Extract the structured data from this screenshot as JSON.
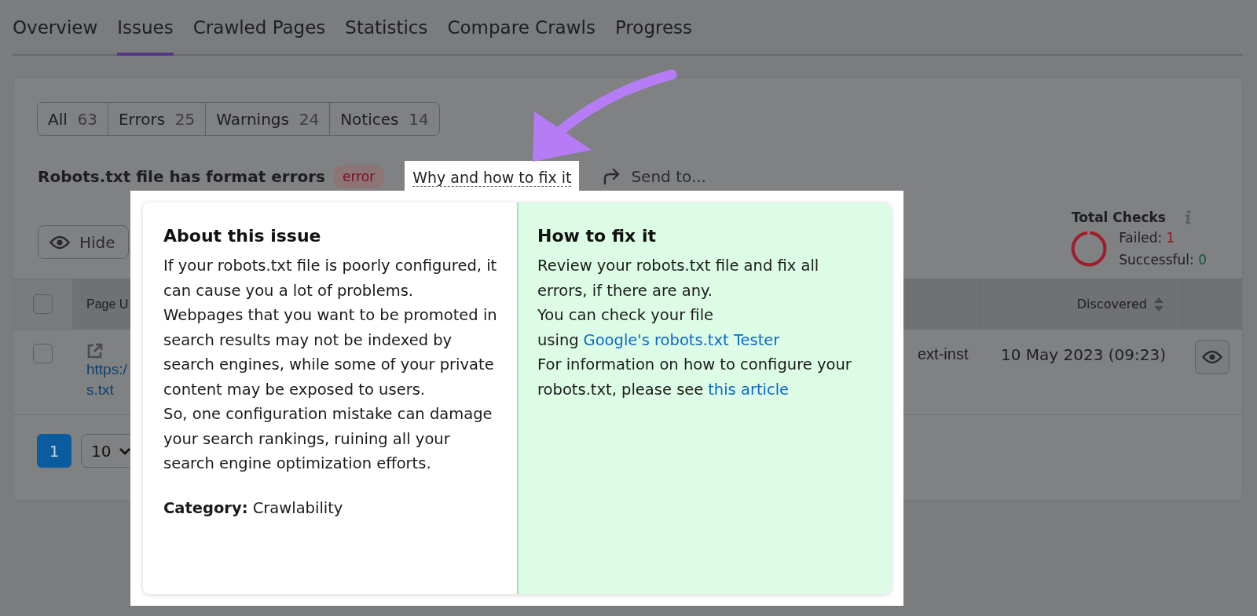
{
  "tabs": [
    {
      "label": "Overview",
      "selected": false
    },
    {
      "label": "Issues",
      "selected": true
    },
    {
      "label": "Crawled Pages",
      "selected": false
    },
    {
      "label": "Statistics",
      "selected": false
    },
    {
      "label": "Compare Crawls",
      "selected": false
    },
    {
      "label": "Progress",
      "selected": false
    }
  ],
  "filters": [
    {
      "label": "All",
      "count": "63"
    },
    {
      "label": "Errors",
      "count": "25"
    },
    {
      "label": "Warnings",
      "count": "24"
    },
    {
      "label": "Notices",
      "count": "14"
    }
  ],
  "issue": {
    "title": "Robots.txt file has format errors",
    "badge": "error",
    "why_link": "Why and how to fix it",
    "send_to": "Send to..."
  },
  "hide_button": "Hide",
  "total_checks": {
    "title": "Total Checks",
    "failed_label": "Failed:",
    "failed": "1",
    "successful_label": "Successful:",
    "successful": "0"
  },
  "table": {
    "all_checked": false,
    "columns": [
      "Page U",
      "Discovered"
    ],
    "rows": [
      {
        "checked": false,
        "url_lines": [
          "https:/",
          "s.txt"
        ],
        "column_3": "ext-inst",
        "discovered": "10 May 2023 (09:23)"
      }
    ]
  },
  "pagination": {
    "pages": [
      {
        "label": "1",
        "selected": true
      }
    ],
    "per_page": "10"
  },
  "popup": {
    "about": {
      "heading": "About this issue",
      "paragraphs": [
        "If your robots.txt file is poorly configured, it can cause you a lot of problems.",
        "Webpages that you want to be promoted in search results may not be indexed by search engines, while some of your private content may be exposed to users.",
        "So, one configuration mistake can damage your search rankings, ruining all your search engine optimization efforts."
      ],
      "category": "**Category:** Crawlability"
    },
    "fix": {
      "heading": "How to fix it",
      "paragraphs": [
        {
          "text": "Review your robots.txt file and fix all errors, if there are any."
        },
        {
          "text": "You can check your file using",
          "link": "Google's robots.txt Tester"
        },
        {
          "text": "For information on how to configure your robots.txt, please see",
          "link": "this article"
        }
      ]
    }
  }
}
